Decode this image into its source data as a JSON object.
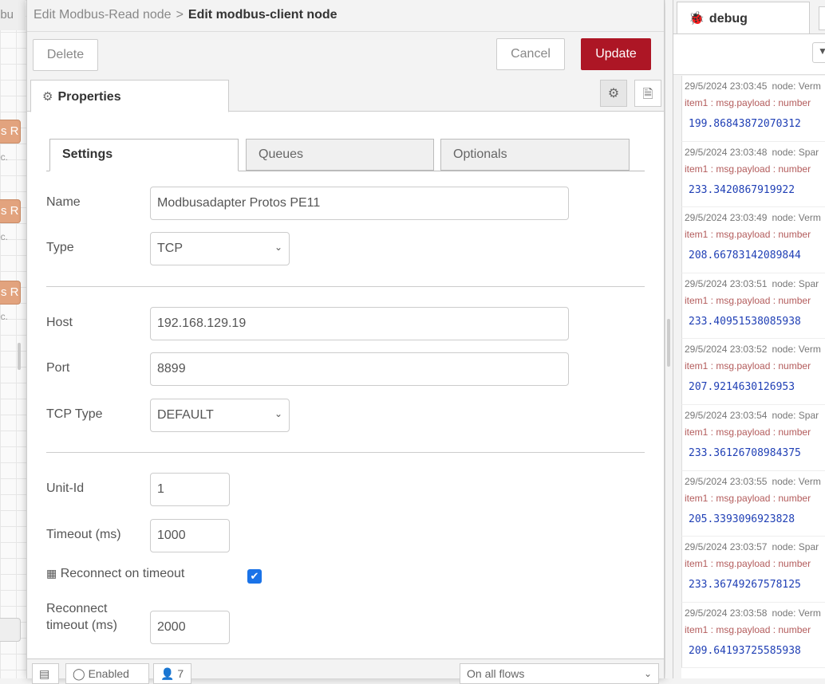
{
  "workspace": {
    "tab_label": "dbu",
    "node_label": "s R",
    "node_sub": "ec."
  },
  "header": {
    "crumb": "Edit Modbus-Read node",
    "separator": ">",
    "current": "Edit modbus-client node"
  },
  "toolbar": {
    "delete_label": "Delete",
    "cancel_label": "Cancel",
    "update_label": "Update",
    "update_color": "#ad1625"
  },
  "tabs": {
    "properties": "Properties",
    "gear_icon": "⚙",
    "doc_icon": "🗎"
  },
  "settings_tabs": [
    "Settings",
    "Queues",
    "Optionals"
  ],
  "form": {
    "name_label": "Name",
    "name_value": "Modbusadapter Protos PE11",
    "type_label": "Type",
    "type_value": "TCP",
    "host_label": "Host",
    "host_value": "192.168.129.19",
    "port_label": "Port",
    "port_value": "8899",
    "tcptype_label": "TCP Type",
    "tcptype_value": "DEFAULT",
    "unitid_label": "Unit-Id",
    "unitid_value": "1",
    "timeout_label": "Timeout (ms)",
    "timeout_value": "1000",
    "reconnect_label": "Reconnect on timeout",
    "reconnect_checked": true,
    "reconnect_timeout_label_1": "Reconnect",
    "reconnect_timeout_label_2": "timeout (ms)",
    "reconnect_timeout_value": "2000"
  },
  "footer": {
    "enabled_label": "Enabled",
    "users_count": "7",
    "flows_value": "On all flows"
  },
  "sidebar": {
    "tab_label": "debug",
    "messages": [
      {
        "time": "29/5/2024 23:03:45",
        "node": "node: Verm",
        "topic": "item1 : msg.payload : number",
        "value": "199.86843872070312"
      },
      {
        "time": "29/5/2024 23:03:48",
        "node": "node: Spar",
        "topic": "item1 : msg.payload : number",
        "value": "233.3420867919922"
      },
      {
        "time": "29/5/2024 23:03:49",
        "node": "node: Verm",
        "topic": "item1 : msg.payload : number",
        "value": "208.66783142089844"
      },
      {
        "time": "29/5/2024 23:03:51",
        "node": "node: Spar",
        "topic": "item1 : msg.payload : number",
        "value": "233.40951538085938"
      },
      {
        "time": "29/5/2024 23:03:52",
        "node": "node: Verm",
        "topic": "item1 : msg.payload : number",
        "value": "207.9214630126953"
      },
      {
        "time": "29/5/2024 23:03:54",
        "node": "node: Spar",
        "topic": "item1 : msg.payload : number",
        "value": "233.36126708984375"
      },
      {
        "time": "29/5/2024 23:03:55",
        "node": "node: Verm",
        "topic": "item1 : msg.payload : number",
        "value": "205.3393096923828"
      },
      {
        "time": "29/5/2024 23:03:57",
        "node": "node: Spar",
        "topic": "item1 : msg.payload : number",
        "value": "233.36749267578125"
      },
      {
        "time": "29/5/2024 23:03:58",
        "node": "node: Verm",
        "topic": "item1 : msg.payload : number",
        "value": "209.64193725585938"
      }
    ]
  }
}
